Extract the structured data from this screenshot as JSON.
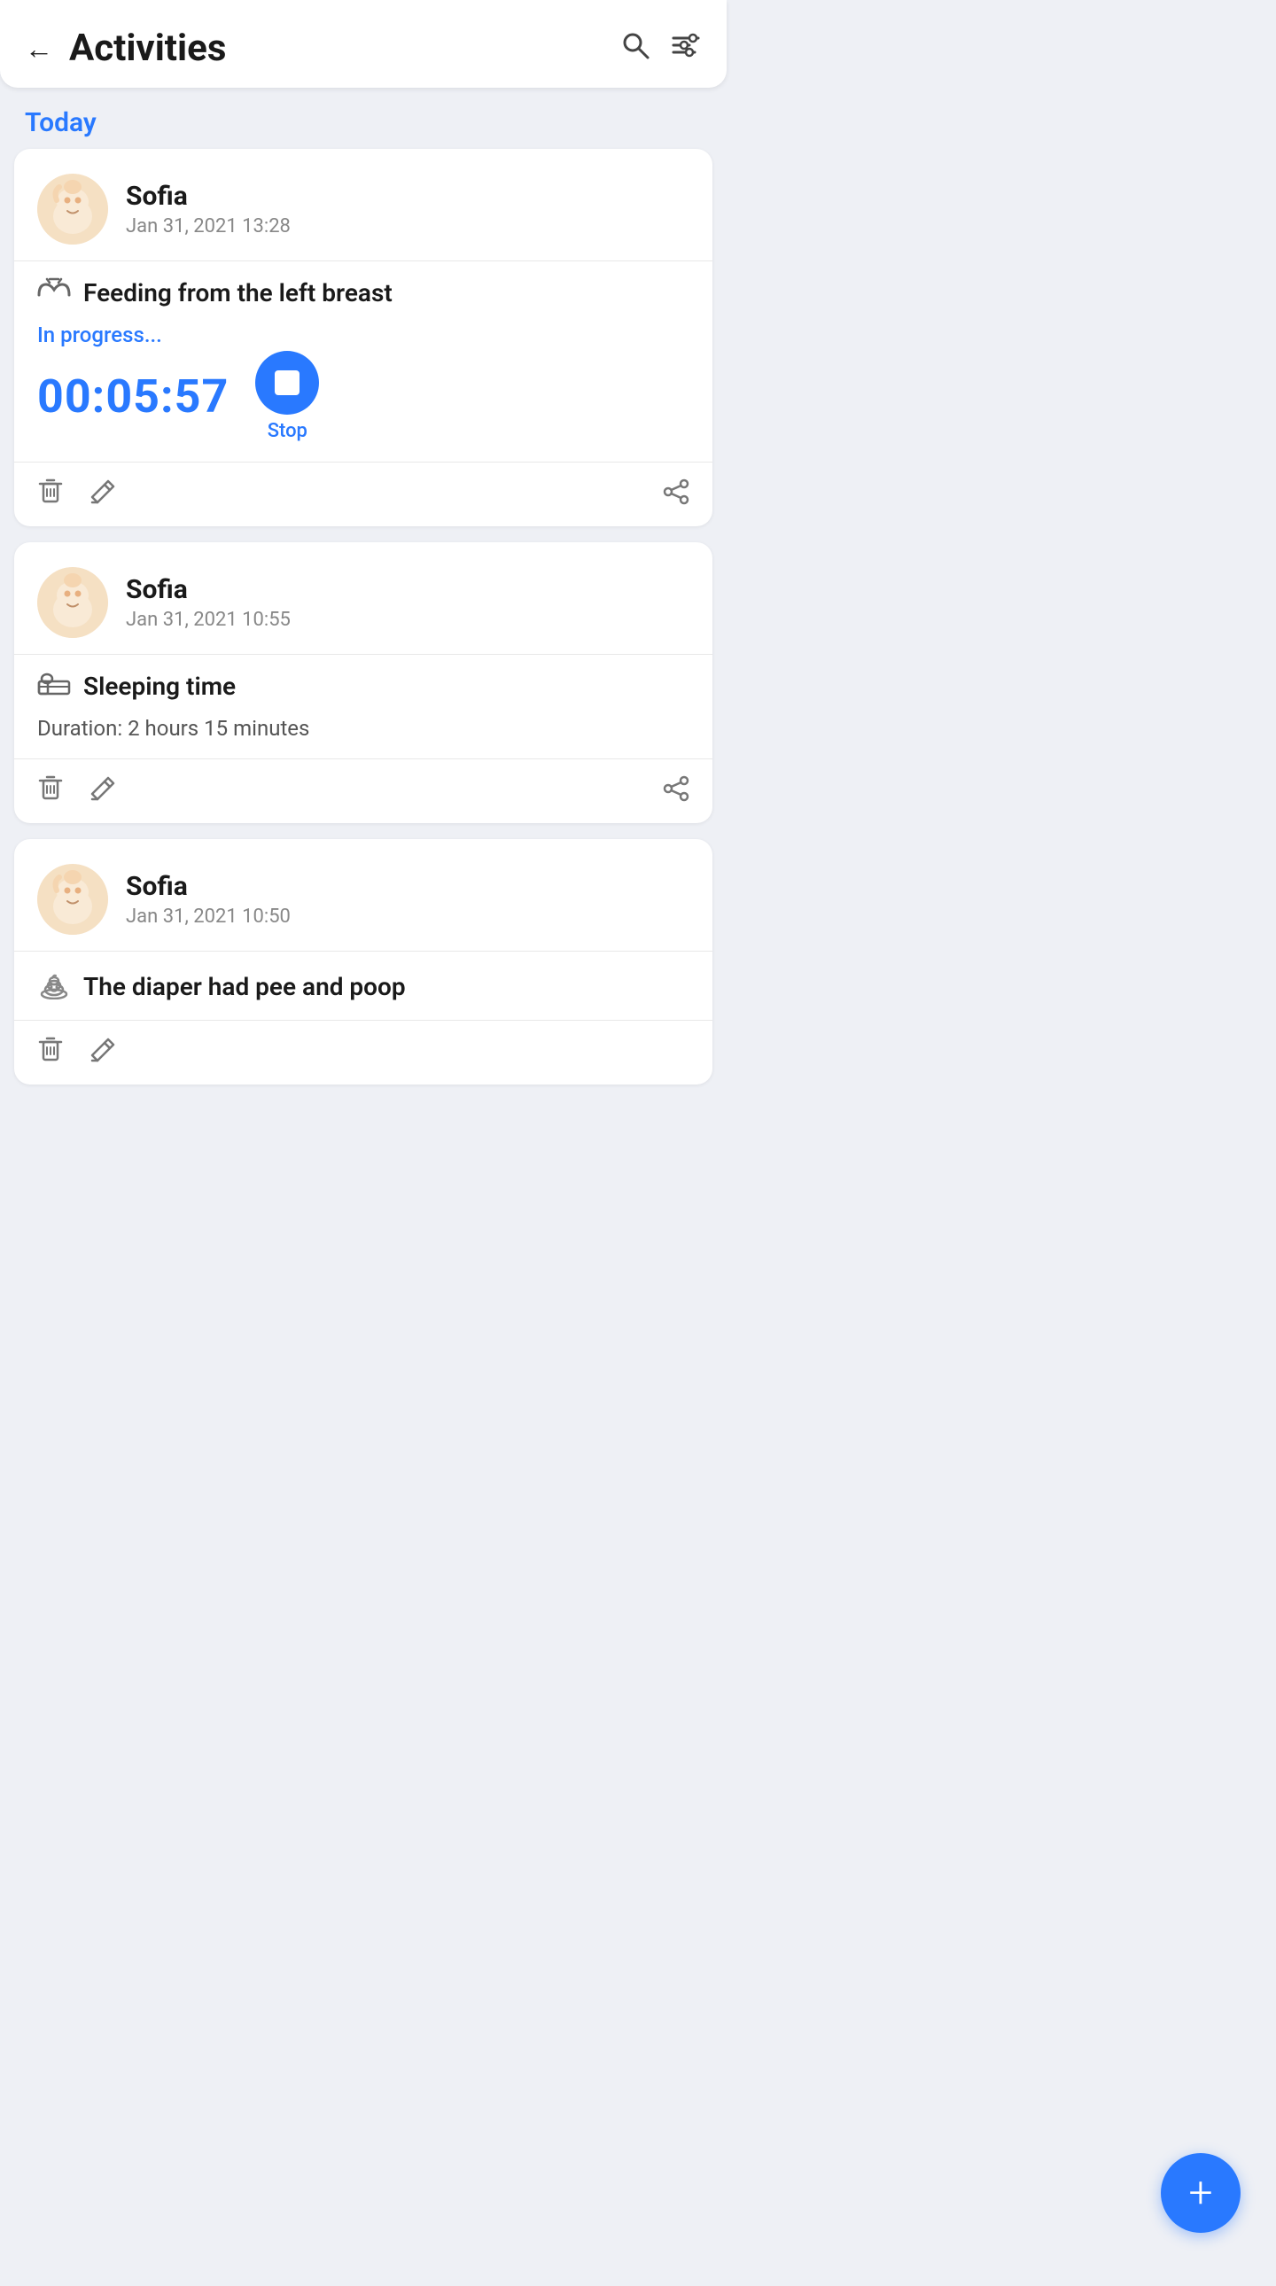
{
  "header": {
    "back_label": "←",
    "title": "Activities",
    "search_icon": "🔍",
    "filter_icon": "⊟"
  },
  "section": {
    "today_label": "Today"
  },
  "cards": [
    {
      "id": "card-feeding",
      "child_name": "Sofia",
      "date": "Jan 31, 2021 13:28",
      "activity_icon": "🍼",
      "activity_label": "Feeding from the left breast",
      "status": "in_progress",
      "in_progress_text": "In progress...",
      "timer": "00:05:57",
      "stop_label": "Stop"
    },
    {
      "id": "card-sleeping",
      "child_name": "Sofia",
      "date": "Jan 31, 2021 10:55",
      "activity_icon": "🛏",
      "activity_label": "Sleeping time",
      "status": "done",
      "duration_text": "Duration: 2 hours 15 minutes"
    },
    {
      "id": "card-diaper",
      "child_name": "Sofia",
      "date": "Jan 31, 2021 10:50",
      "activity_icon": "🚼",
      "activity_label": "The diaper had pee and poop",
      "status": "done"
    }
  ],
  "fab": {
    "label": "+"
  }
}
